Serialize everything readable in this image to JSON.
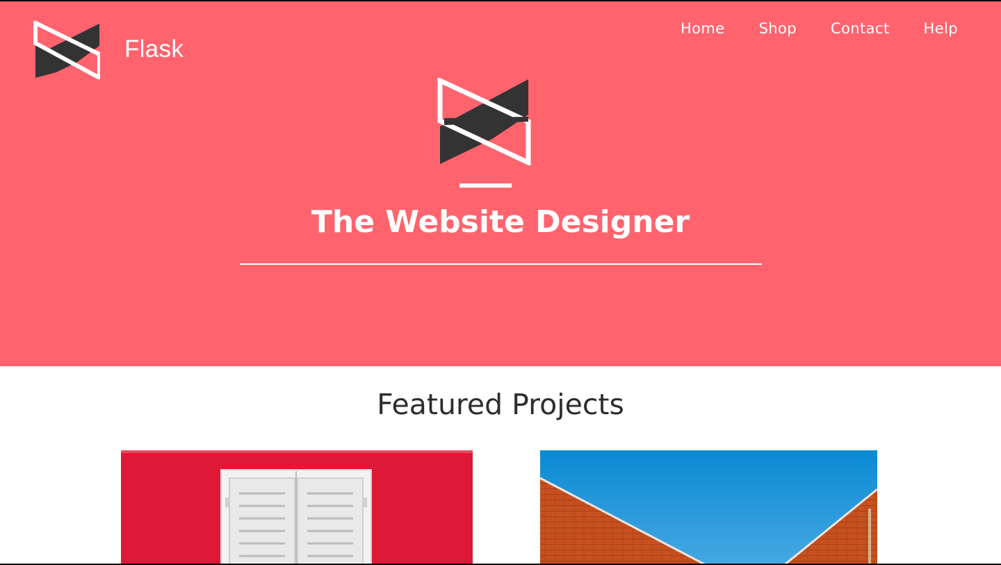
{
  "header": {
    "brand_name": "Flask",
    "nav": [
      {
        "label": "Home"
      },
      {
        "label": "Shop"
      },
      {
        "label": "Contact"
      },
      {
        "label": "Help"
      }
    ]
  },
  "hero": {
    "title": "The Website Designer",
    "background_color": "#ff646e"
  },
  "featured": {
    "title": "Featured Projects",
    "projects": [
      {
        "image": "red-wall-white-shutters"
      },
      {
        "image": "brick-roof-blue-sky"
      }
    ]
  },
  "icons": {
    "brand": "flask-logo-icon",
    "hero": "flask-hero-logo-icon"
  }
}
